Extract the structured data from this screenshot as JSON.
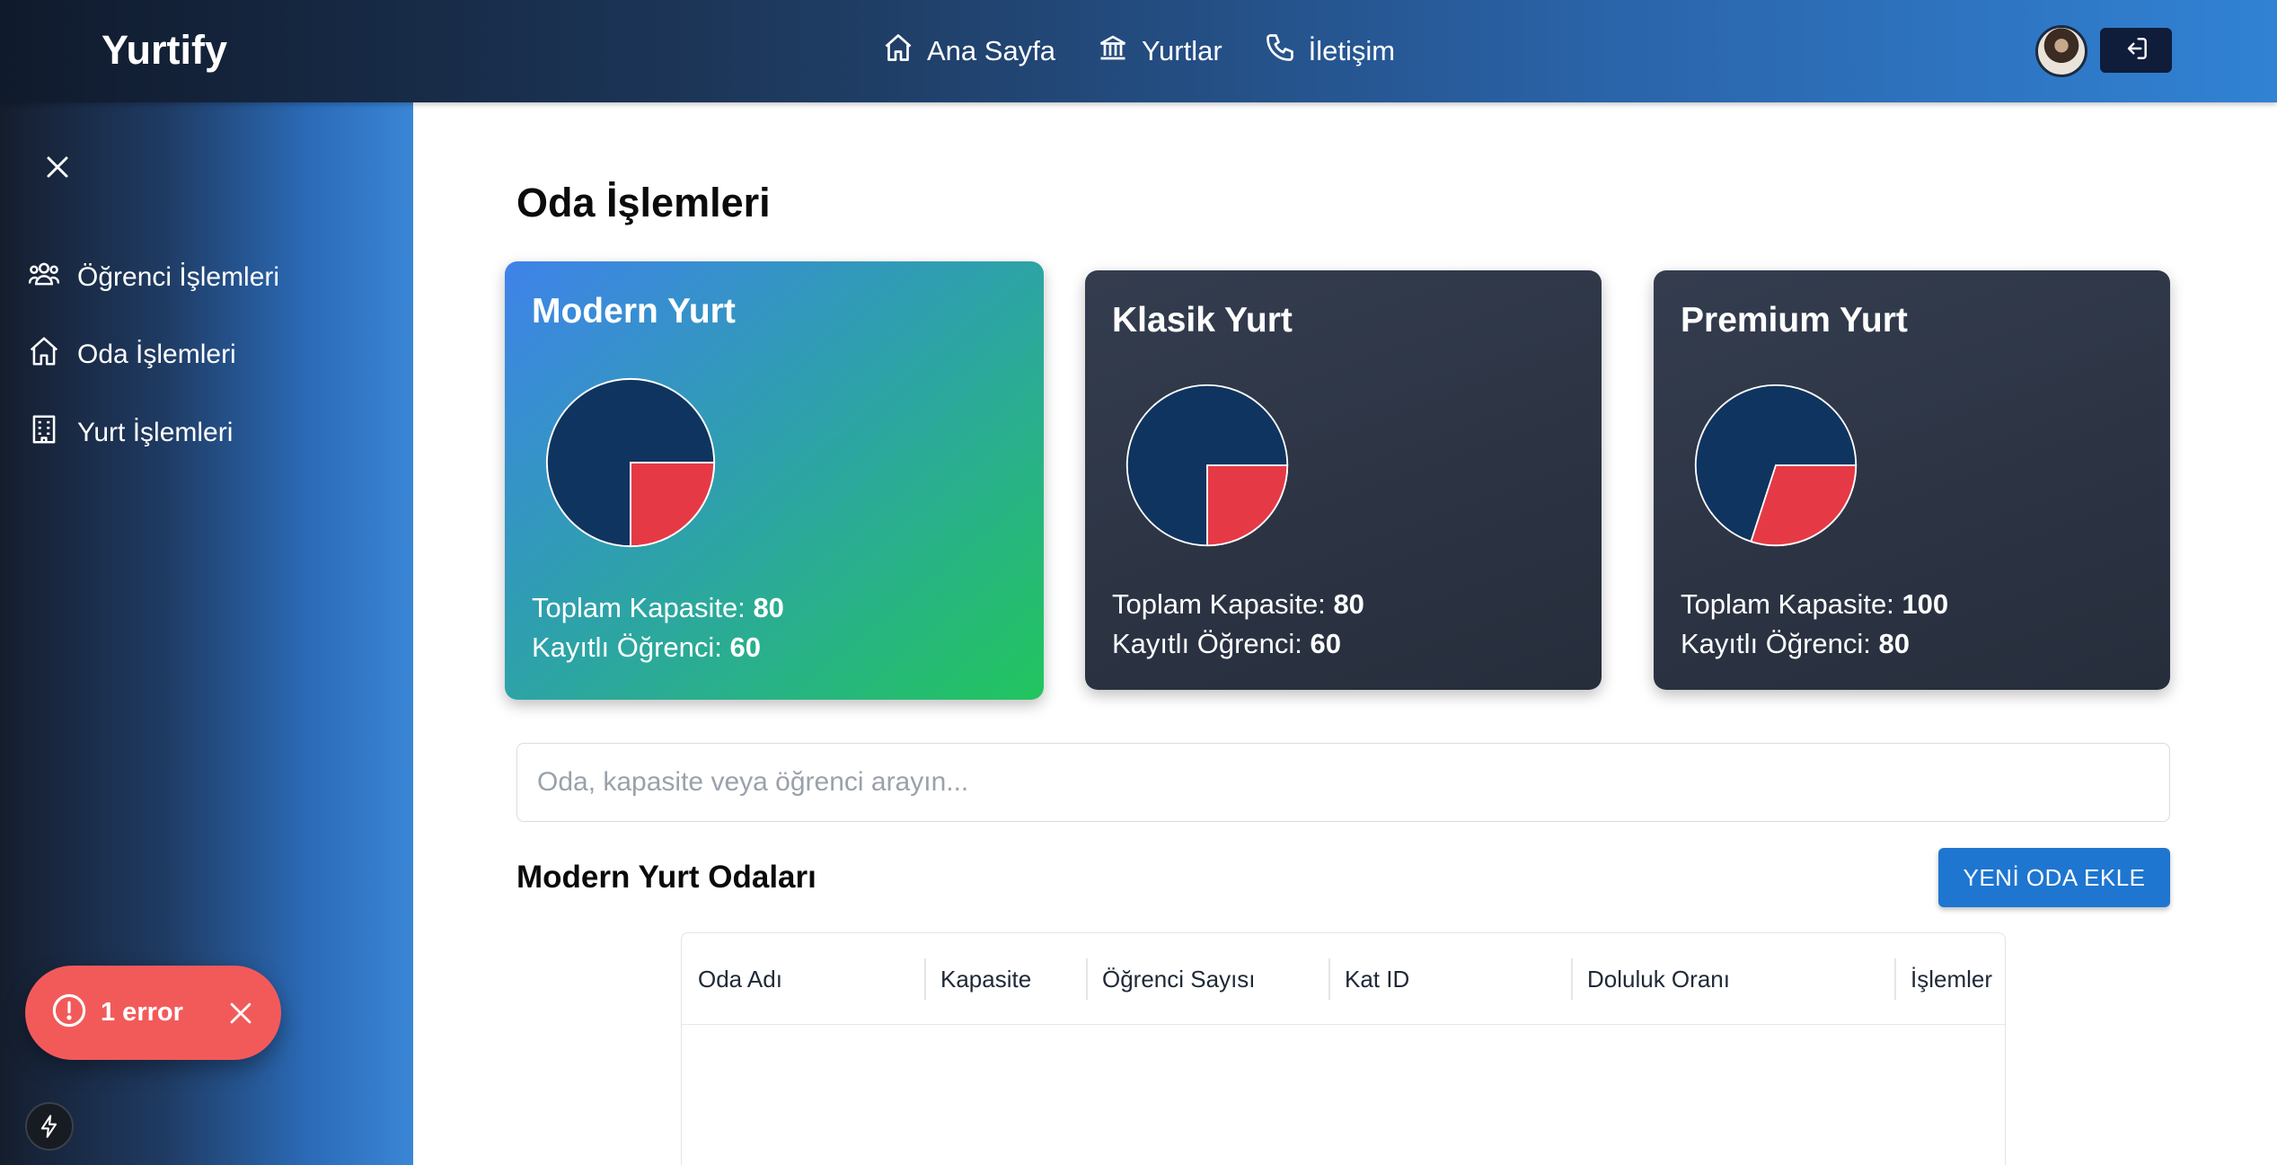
{
  "header": {
    "brand": "Yurtify",
    "nav": [
      {
        "label": "Ana Sayfa",
        "icon": "home-icon"
      },
      {
        "label": "Yurtlar",
        "icon": "bank-icon"
      },
      {
        "label": "İletişim",
        "icon": "phone-icon"
      }
    ],
    "logout_icon": "logout-icon"
  },
  "sidebar": {
    "items": [
      {
        "label": "Öğrenci İşlemleri",
        "icon": "users-icon"
      },
      {
        "label": "Oda İşlemleri",
        "icon": "home-icon"
      },
      {
        "label": "Yurt İşlemleri",
        "icon": "building-icon"
      }
    ]
  },
  "error_toast": {
    "label": "1 error"
  },
  "main": {
    "title": "Oda İşlemleri",
    "cards": [
      {
        "name": "Modern Yurt",
        "capacity_label": "Toplam Kapasite:",
        "capacity": "80",
        "registered_label": "Kayıtlı Öğrenci:",
        "registered": "60",
        "active": true
      },
      {
        "name": "Klasik Yurt",
        "capacity_label": "Toplam Kapasite:",
        "capacity": "80",
        "registered_label": "Kayıtlı Öğrenci:",
        "registered": "60",
        "active": false
      },
      {
        "name": "Premium Yurt",
        "capacity_label": "Toplam Kapasite:",
        "capacity": "100",
        "registered_label": "Kayıtlı Öğrenci:",
        "registered": "80",
        "active": false
      }
    ],
    "search": {
      "placeholder": "Oda, kapasite veya öğrenci arayın..."
    },
    "section_title": "Modern Yurt Odaları",
    "add_button": "YENİ ODA EKLE",
    "table": {
      "columns": [
        "Oda Adı",
        "Kapasite",
        "Öğrenci Sayısı",
        "Kat ID",
        "Doluluk Oranı",
        "İşlemler"
      ],
      "rows": []
    }
  },
  "colors": {
    "pie_occupied": "#0f3460",
    "pie_free": "#e63946",
    "primary_button": "#1e76d0",
    "toast": "#f25a5a"
  }
}
